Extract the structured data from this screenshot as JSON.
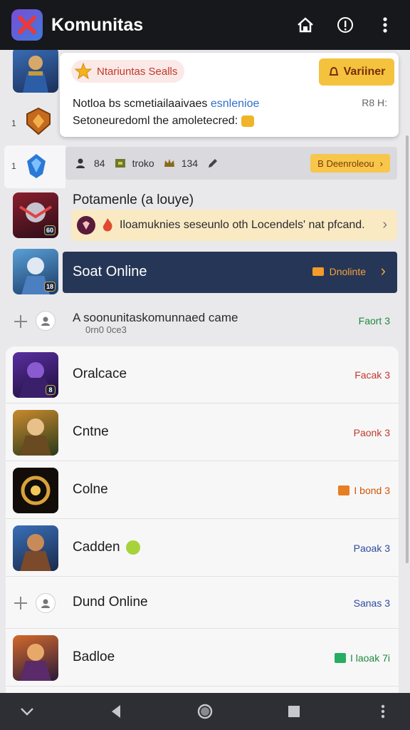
{
  "app": {
    "title": "Komunitas"
  },
  "notification": {
    "badge": "Ntariuntas Sealls",
    "button": "Variiner",
    "text_line1": "Notloa bs scmetiailaaivaes",
    "text_link": "esnlenioe",
    "text_line2": "Setoneuredoml the amoletecred:",
    "time": "R8 H:"
  },
  "side_numbers": {
    "row1": "1",
    "row2": "1"
  },
  "stats": {
    "stat1_value": "84",
    "stat2_value": "troko",
    "stat3_value": "134",
    "pill": "B Deenroleou"
  },
  "row_postname": {
    "title": "Potamenle (a louye)",
    "banner": "Iloamuknies seseunlo oth Locendels' nat pfcand."
  },
  "highlight": {
    "title": "Soat Online",
    "tag": "Dnolinte",
    "level": "18"
  },
  "community_row": {
    "text": "A soonunitaskomunnaed came",
    "sub": "0rn0 0ce3",
    "status": "Faort 3"
  },
  "thumb_levels": {
    "t1": "60",
    "t2": "8"
  },
  "list": [
    {
      "name": "Oralcace",
      "status": "Facak 3",
      "status_color": "#c0392b"
    },
    {
      "name": "Cntne",
      "status": "Paonk 3",
      "status_color": "#c0392b"
    },
    {
      "name": "Colne",
      "status": "I bond 3",
      "status_color": "#d35400"
    },
    {
      "name": "Cadden",
      "status": "Paoak 3",
      "status_color": "#2e4a9e"
    },
    {
      "name": "Dund Online",
      "status": "Sanas 3",
      "status_color": "#2e4a9e"
    },
    {
      "name": "Badloe",
      "status": "I laoak 7i",
      "status_color": "#1f8a3b"
    }
  ],
  "colors": {
    "topbar": "#17181c",
    "accent_yellow": "#f5c23d",
    "highlight_bg": "#263656",
    "navbar": "#2d2f34"
  }
}
